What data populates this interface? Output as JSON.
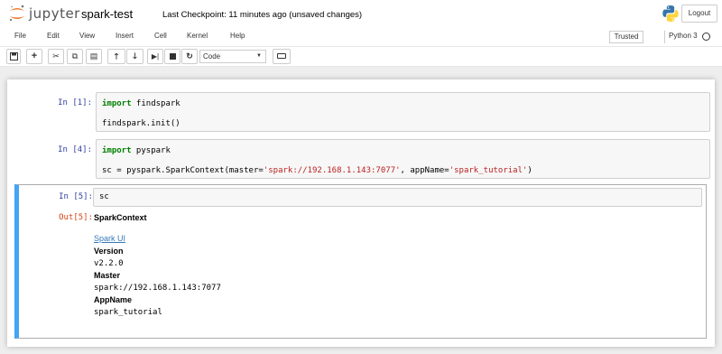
{
  "header": {
    "logo_text": "jupyter",
    "notebook_name": "spark-test",
    "checkpoint": "Last Checkpoint: 11 minutes ago (unsaved changes)",
    "logout_label": "Logout"
  },
  "menubar": {
    "items": [
      "File",
      "Edit",
      "View",
      "Insert",
      "Cell",
      "Kernel",
      "Help"
    ],
    "trusted_label": "Trusted",
    "kernel_name": "Python 3"
  },
  "toolbar": {
    "buttons": [
      "save-icon",
      "plus-icon",
      "cut-icon",
      "copy-icon",
      "paste-icon",
      "arrow-up-icon",
      "arrow-down-icon",
      "run-icon",
      "stop-icon",
      "restart-icon",
      "keyboard-icon"
    ],
    "cell_type": "Code"
  },
  "cells": [
    {
      "prompt": "In [1]:",
      "line1_kw": "import",
      "line1_rest": " findspark",
      "line2": "findspark.init()"
    },
    {
      "prompt": "In [4]:",
      "line1_kw": "import",
      "line1_rest": " pyspark",
      "line2_a": "sc = pyspark.SparkContext(master=",
      "line2_str1": "'spark://192.168.1.143:7077'",
      "line2_b": ", appName=",
      "line2_str2": "'spark_tutorial'",
      "line2_c": ")"
    },
    {
      "prompt": "In [5]:",
      "code": "sc",
      "out_prompt": "Out[5]:",
      "output": {
        "title": "SparkContext",
        "link": "Spark UI",
        "version_label": "Version",
        "version_value": "v2.2.0",
        "master_label": "Master",
        "master_value": "spark://192.168.1.143:7077",
        "appname_label": "AppName",
        "appname_value": "spark_tutorial"
      }
    }
  ],
  "colors": {
    "accent": "#42a5f5",
    "prompt_in": "#303f9f",
    "prompt_out": "#d84315",
    "keyword": "#008000",
    "string": "#ba2121",
    "link": "#337ab7"
  }
}
